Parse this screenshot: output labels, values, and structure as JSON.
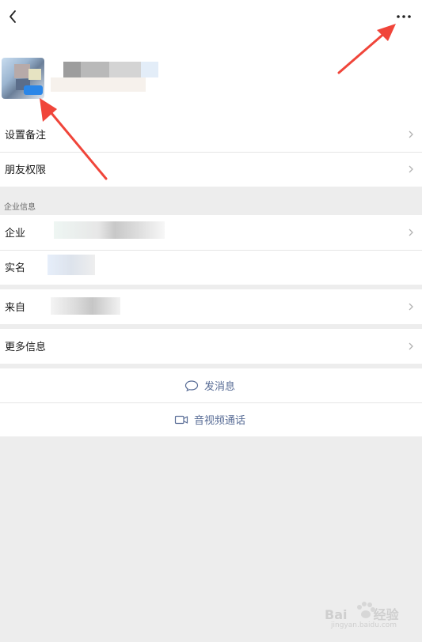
{
  "header": {
    "back_icon": "chevron-left-icon",
    "more_icon": "ellipsis-icon"
  },
  "profile": {
    "avatar": "avatar-image-pixelated",
    "name": ""
  },
  "section_basic": {
    "items": [
      {
        "label": "设置备注"
      },
      {
        "label": "朋友权限"
      }
    ]
  },
  "section_company": {
    "caption": "企业信息",
    "items": [
      {
        "label": "企业"
      },
      {
        "label": "实名"
      }
    ]
  },
  "section_from": {
    "items": [
      {
        "label": "来自"
      }
    ]
  },
  "section_more": {
    "items": [
      {
        "label": "更多信息"
      }
    ]
  },
  "actions": {
    "message_label": "发消息",
    "call_label": "音视频通话"
  },
  "watermark": {
    "brand": "Bai",
    "brand_suffix": "经验",
    "url": "jingyan.baidu.com"
  },
  "colors": {
    "accent": "#576b95",
    "arrow": "#f0453a",
    "background": "#ededed"
  }
}
